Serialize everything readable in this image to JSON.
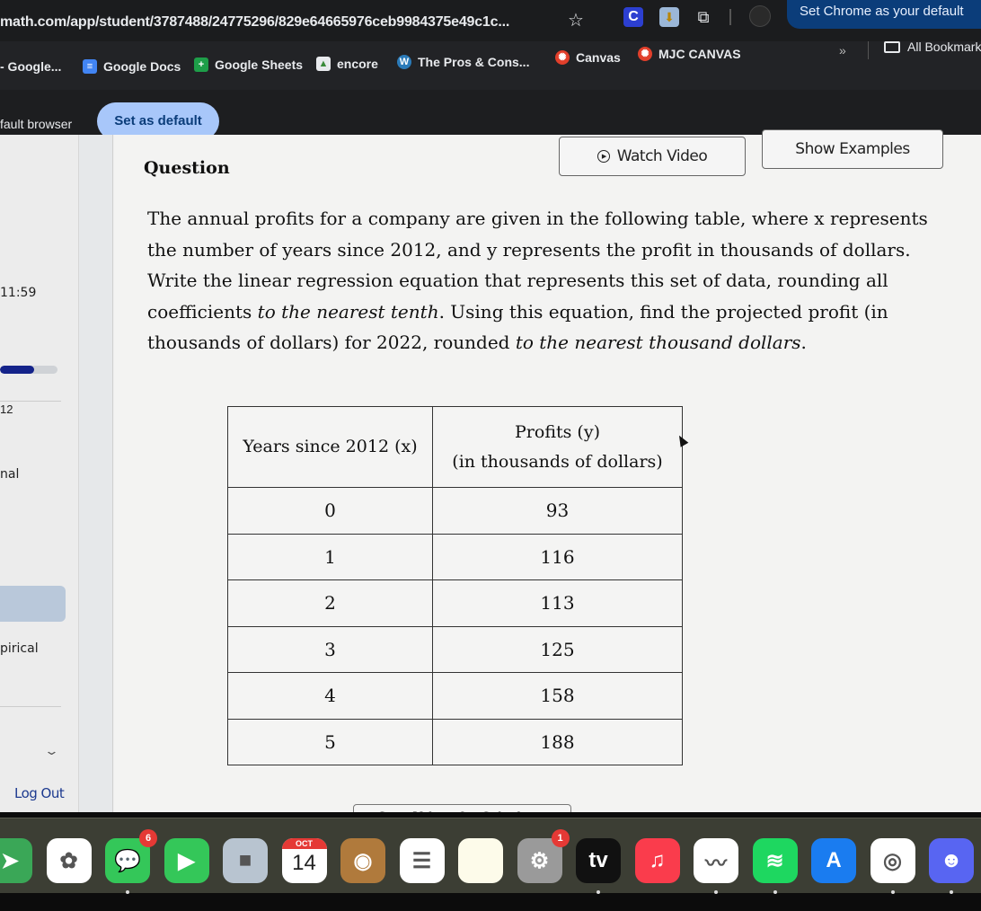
{
  "browser": {
    "url": "math.com/app/student/3787488/24775296/829e64665976ceb9984375e49c1c...",
    "default_banner": "Set Chrome as your default",
    "extensions": [
      {
        "name": "c-extension",
        "glyph": "C"
      },
      {
        "name": "bookmark-extension",
        "glyph": "⬇"
      },
      {
        "name": "puzzle-extension",
        "glyph": "⧉"
      }
    ],
    "bookmarks": [
      {
        "label": "- Google...",
        "icon": "none"
      },
      {
        "label": "Google Docs",
        "icon": "google-docs-icon",
        "glyph": "≡"
      },
      {
        "label": "Google Sheets",
        "icon": "google-sheets-icon",
        "glyph": "+"
      },
      {
        "label": "encore",
        "icon": "encore-icon",
        "glyph": "▲"
      },
      {
        "label": "The Pros & Cons...",
        "icon": "wordpress-icon",
        "glyph": "W"
      },
      {
        "label": "Canvas",
        "icon": "canvas-icon",
        "glyph": "✺"
      },
      {
        "label": "MJC CANVAS",
        "icon": "canvas-icon",
        "glyph": "✺"
      }
    ],
    "more_bookmarks": "»",
    "all_bookmarks": "All Bookmarks",
    "infobar_text": "fault browser",
    "set_default_button": "Set as default"
  },
  "sidebar": {
    "due_time": "11:59",
    "progress_percent": 60,
    "number_fragment": "12",
    "item_fragment_1": "nal",
    "item_fragment_2": "pirical",
    "chevron": "⌄",
    "logout": "Log Out"
  },
  "question": {
    "title": "Question",
    "watch_video": "Watch Video",
    "show_examples": "Show Examples",
    "prompt_part1": "The annual profits for a company are given in the following table, where x represents the number of years since 2012, and y represents the profit in thousands of dollars. Write the linear regression equation that represents this set of data, rounding all coefficients ",
    "prompt_em1": "to the nearest tenth",
    "prompt_part2": ". Using this equation, find the projected profit (in thousands of dollars) for 2022, rounded ",
    "prompt_em2": "to the nearest thousand dollars",
    "prompt_part3": ".",
    "table": {
      "header_x": "Years since 2012 (x)",
      "header_y_line1": "Profits (y)",
      "header_y_line2": "(in thousands of dollars)",
      "rows": [
        {
          "x": "0",
          "y": "93"
        },
        {
          "x": "1",
          "y": "116"
        },
        {
          "x": "2",
          "y": "113"
        },
        {
          "x": "3",
          "y": "125"
        },
        {
          "x": "4",
          "y": "158"
        },
        {
          "x": "5",
          "y": "188"
        }
      ]
    },
    "copy_button": "Copy Values for Calculator"
  },
  "dock": {
    "apps": [
      {
        "name": "maps",
        "bg": "#3aa757",
        "glyph": "➤",
        "running": false
      },
      {
        "name": "photos",
        "bg": "#ffffff",
        "glyph": "✿",
        "running": false
      },
      {
        "name": "messages",
        "bg": "#34c759",
        "glyph": "💬",
        "badge": "6",
        "running": true
      },
      {
        "name": "facetime",
        "bg": "#34c759",
        "glyph": "▶",
        "running": false
      },
      {
        "name": "roblox",
        "bg": "#b8c4d0",
        "glyph": "■",
        "running": false
      },
      {
        "name": "calendar",
        "bg": "#ffffff",
        "month": "OCT",
        "day": "14",
        "running": false
      },
      {
        "name": "contacts",
        "bg": "#b07a3c",
        "glyph": "◉",
        "running": false
      },
      {
        "name": "reminders",
        "bg": "#ffffff",
        "glyph": "☰",
        "running": false
      },
      {
        "name": "notes",
        "bg": "#fdfbea",
        "glyph": "",
        "running": false
      },
      {
        "name": "system-settings",
        "bg": "#9a9a9a",
        "glyph": "⚙",
        "badge": "1",
        "running": false
      },
      {
        "name": "apple-tv",
        "bg": "#111111",
        "glyph": "tv",
        "running": true
      },
      {
        "name": "music",
        "bg": "#fa3c4c",
        "glyph": "♫",
        "running": false
      },
      {
        "name": "freeform",
        "bg": "#ffffff",
        "glyph": "〰",
        "running": true
      },
      {
        "name": "spotify",
        "bg": "#1ed760",
        "glyph": "≋",
        "running": true
      },
      {
        "name": "app-store",
        "bg": "#1a7cf0",
        "glyph": "A",
        "running": false
      },
      {
        "name": "chrome",
        "bg": "#ffffff",
        "glyph": "◎",
        "running": true
      },
      {
        "name": "discord",
        "bg": "#5865f2",
        "glyph": "☻",
        "running": true
      }
    ]
  }
}
